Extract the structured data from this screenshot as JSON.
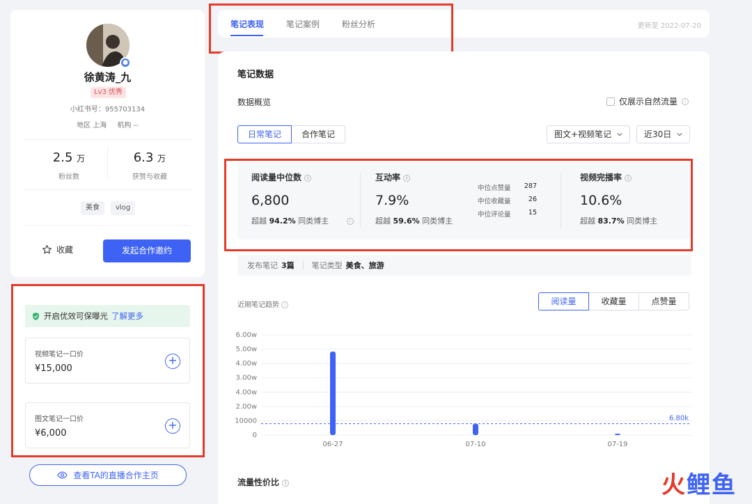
{
  "profile": {
    "username": "徐黄涛_九",
    "level_badge": "Lv3 优秀",
    "redbook_id": "小红书号：955703134",
    "region": "地区 上海",
    "agency": "机构 --",
    "followers_value": "2.5",
    "followers_unit": "万",
    "followers_label": "粉丝数",
    "likes_value": "6.3",
    "likes_unit": "万",
    "likes_label": "获赞与收藏",
    "tags": [
      "美食",
      "vlog"
    ],
    "favorite_label": "收藏",
    "invite_label": "发起合作邀约"
  },
  "pricing": {
    "boost_text": "开启优效可保曝光",
    "boost_link": "了解更多",
    "video_title": "视频笔记一口价",
    "video_price": "¥15,000",
    "image_title": "图文笔记一口价",
    "image_price": "¥6,000"
  },
  "live_link_label": "查看TA的直播合作主页",
  "tabs": [
    {
      "label": "笔记表现",
      "active": true
    },
    {
      "label": "笔记案例",
      "active": false
    },
    {
      "label": "粉丝分析",
      "active": false
    }
  ],
  "updated_text": "更新至 2022-07-20",
  "main": {
    "section_title": "笔记数据",
    "overview_label": "数据概览",
    "natural_only_label": "仅展示自然流量",
    "note_type_tabs": [
      "日常笔记",
      "合作笔记"
    ],
    "content_filter": "图文+视频笔记",
    "period_filter": "近30日"
  },
  "metrics": {
    "reads": {
      "label": "阅读量中位数",
      "value": "6,800",
      "beat_prefix": "超越",
      "beat": "94.2%",
      "beat_suffix": "同类博主"
    },
    "engagement": {
      "label": "互动率",
      "value": "7.9%",
      "beat_prefix": "超越",
      "beat": "59.6%",
      "beat_suffix": "同类博主"
    },
    "mini": [
      {
        "label": "中位点赞量",
        "value": "287"
      },
      {
        "label": "中位收藏量",
        "value": "26"
      },
      {
        "label": "中位评论量",
        "value": "15"
      }
    ],
    "completion": {
      "label": "视频完播率",
      "value": "10.6%",
      "beat_prefix": "超越",
      "beat": "83.7%",
      "beat_suffix": "同类博主"
    }
  },
  "summary": {
    "published_label": "发布笔记",
    "published_value": "3篇",
    "category_label": "笔记类型",
    "category_value": "美食、旅游"
  },
  "trend": {
    "label": "近期笔记趋势",
    "metric_tabs": [
      "阅读量",
      "收藏量",
      "点赞量"
    ]
  },
  "flow_title": "流量性价比",
  "watermark": {
    "part1": "火",
    "part2": "鲤",
    "part3": "鱼"
  },
  "colors": {
    "accent": "#3e63f4",
    "highlight_red": "#e33a2a"
  },
  "chart_data": {
    "type": "bar",
    "title": "近期笔记趋势",
    "y_ticks": [
      "0",
      "10000",
      "2.00w",
      "4.00w",
      "3.00w",
      "4.00w",
      "5.00w",
      "6.00w"
    ],
    "x_ticks": [
      "06-27",
      "07-10",
      "07-19"
    ],
    "series": [
      {
        "name": "阅读量",
        "values": [
          50000,
          6800,
          800
        ]
      }
    ],
    "median_line": {
      "value": 6800,
      "label": "6.80k"
    },
    "ylim": [
      0,
      60000
    ],
    "grid": true
  }
}
